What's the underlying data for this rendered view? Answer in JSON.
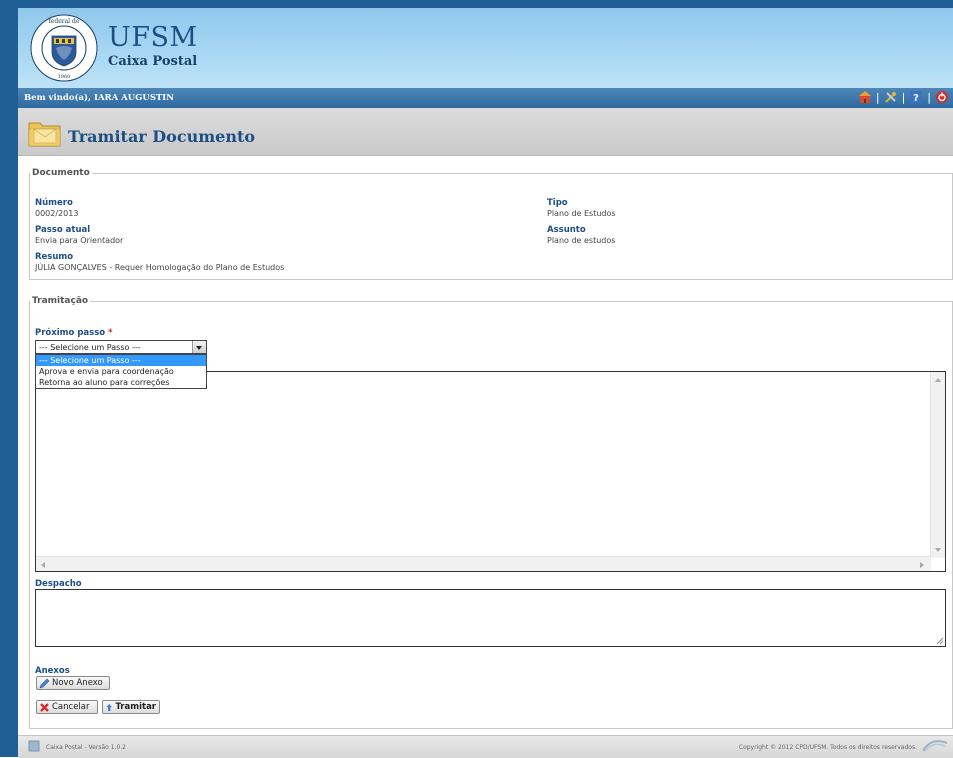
{
  "app": {
    "title": "UFSM",
    "subtitle": "Caixa Postal",
    "seal_text": "Universidade Federal de Santa Maria",
    "seal_year": "1960"
  },
  "welcome": {
    "text": "Bem vindo(a), IARA AUGUSTIN"
  },
  "toolbar_icons": [
    "home-icon",
    "tools-icon",
    "help-icon",
    "logout-icon"
  ],
  "page": {
    "title": "Tramitar Documento"
  },
  "documento": {
    "legend": "Documento",
    "numero_label": "Número",
    "numero": "0002/2013",
    "tipo_label": "Tipo",
    "tipo": "Plano de Estudos",
    "passo_label": "Passo atual",
    "passo": "Envia para Orientador",
    "assunto_label": "Assunto",
    "assunto": "Plano de estudos",
    "resumo_label": "Resumo",
    "resumo": "JÚLIA GONÇALVES - Requer Homologação do Plano de Estudos"
  },
  "tramitacao": {
    "legend": "Tramitação",
    "proximo_label": "Próximo passo",
    "required_mark": "*",
    "selected": "--- Selecione um Passo ---",
    "options": [
      "--- Selecione um Passo ---",
      "Aprova e envia para coordenação",
      "Retorna ao aluno para correções"
    ],
    "despacho_label": "Despacho",
    "anexos_label": "Anexos",
    "novo_anexo": "Novo Anexo",
    "cancelar": "Cancelar",
    "tramitar": "Tramitar"
  },
  "footer": {
    "left": "Caixa Postal - Versão 1.0.2",
    "right": "Copyright © 2012 CPD/UFSM. Todos os direitos reservados."
  },
  "colors": {
    "header": "#a9d8f3",
    "welcome_bar": "#2f6aa1",
    "title": "#1d4e84",
    "selection": "#3399ff"
  }
}
